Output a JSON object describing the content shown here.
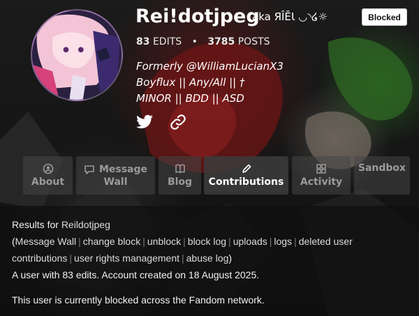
{
  "profile": {
    "username": "Rei!dotjpeg",
    "aka": "aka ЯÎĒƖ ◡◝໒☼",
    "badge": "Blocked",
    "stats": {
      "edits_count": "83",
      "edits_label": "EDITS",
      "separator": "•",
      "posts_count": "3785",
      "posts_label": "POSTS"
    },
    "bio": [
      "Formerly @WilliamLucianX3",
      "Boyflux || Any/All || †",
      "MINOR || BDD || ASD"
    ],
    "social_icons": [
      "twitter-icon",
      "link-icon"
    ]
  },
  "tabs": [
    {
      "name": "About",
      "icon": "user-circle-icon",
      "lines": [
        "About"
      ]
    },
    {
      "name": "Message Wall",
      "icon": "speech-bubble-icon",
      "lines": [
        "Message",
        "Wall"
      ]
    },
    {
      "name": "Blog",
      "icon": "book-icon",
      "lines": [
        "Blog"
      ]
    },
    {
      "name": "Contributions",
      "icon": "pencil-icon",
      "lines": [
        "Contributions"
      ],
      "active": true
    },
    {
      "name": "Activity",
      "icon": "grid-icon",
      "lines": [
        "Activity"
      ]
    },
    {
      "name": "Sandbox",
      "icon": "",
      "lines": [
        "Sandbox"
      ]
    }
  ],
  "content": {
    "results_prefix": "Results for",
    "results_user": "Reildotjpeg",
    "links": [
      "Message Wall",
      "change block",
      "unblock",
      "block log",
      "uploads",
      "logs",
      "deleted user contributions",
      "user rights management",
      "abuse log"
    ],
    "open_paren": "(",
    "close_paren": ")",
    "link_separator": "|",
    "summary": "A user with 83 edits. Account created on 18 August 2025.",
    "blocked_notice": "This user is currently blocked across the Fandom network."
  },
  "colors": {
    "background": "#141414",
    "text": "#ffffff",
    "tab_inactive_text": "#9a9a9a",
    "tab_active_text": "#ffffff"
  }
}
